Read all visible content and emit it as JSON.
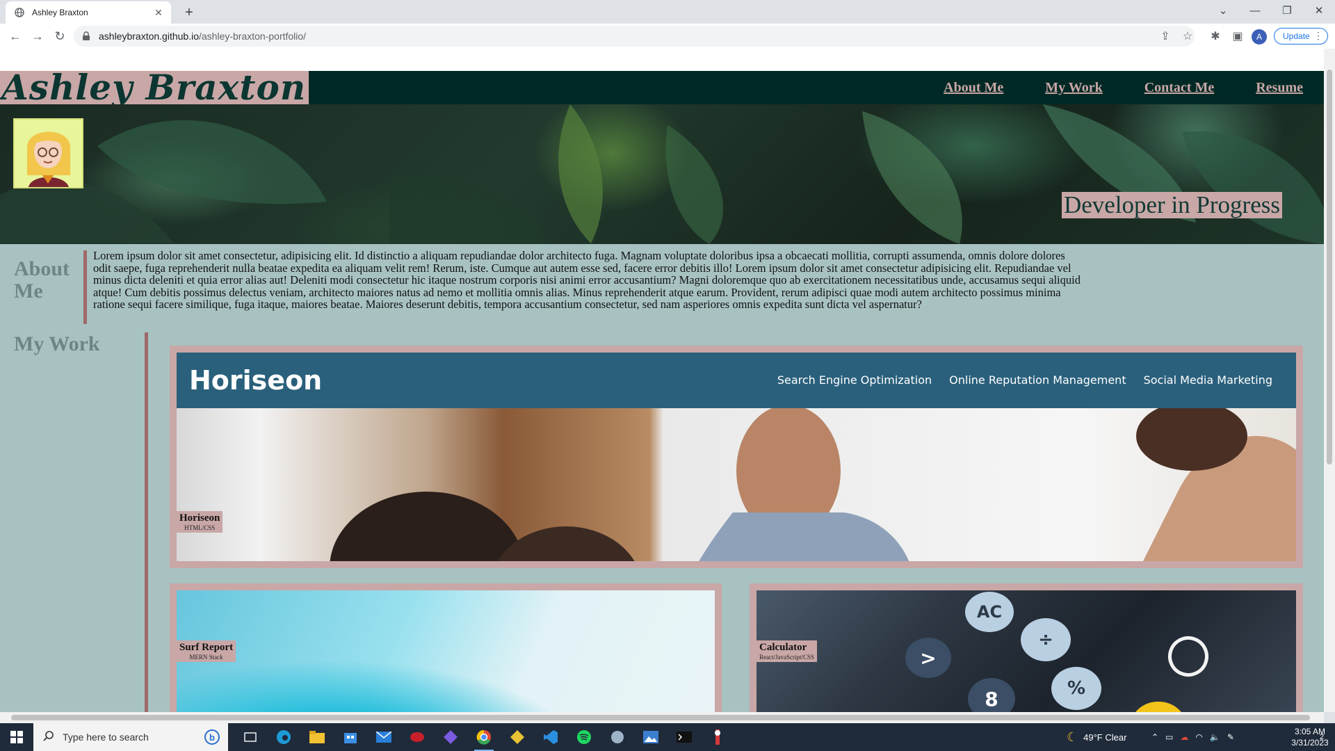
{
  "browser": {
    "tab_title": "Ashley Braxton",
    "new_tab_label": "+",
    "url_host": "ashleybraxton.github.io",
    "url_path": "/ashley-braxton-portfolio/",
    "update_label": "Update",
    "avatar_initial": "A"
  },
  "site": {
    "title": "Ashley Braxton",
    "nav": [
      "About Me",
      "My Work",
      "Contact Me",
      "Resume"
    ],
    "tagline": "Developer in Progress",
    "about_heading": "About Me",
    "about_text": "Lorem ipsum dolor sit amet consectetur, adipisicing elit. Id distinctio a aliquam repudiandae dolor architecto fuga. Magnam voluptate doloribus ipsa a obcaecati mollitia, corrupti assumenda, omnis dolore dolores odit saepe, fuga reprehenderit nulla beatae expedita ea aliquam velit rem! Rerum, iste. Cumque aut autem esse sed, facere error debitis illo! Lorem ipsum dolor sit amet consectetur adipisicing elit. Repudiandae vel minus dicta deleniti et quia error alias aut! Deleniti modi consectetur hic itaque nostrum corporis nisi animi error accusantium? Magni doloremque quo ab exercitationem necessitatibus unde, accusamus sequi aliquid atque! Cum debitis possimus delectus veniam, architecto maiores natus ad nemo et mollitia omnis alias. Minus reprehenderit atque earum. Provident, rerum adipisci quae modi autem architecto possimus minima ratione sequi facere similique, fuga itaque, maiores beatae. Maiores deserunt debitis, tempora accusantium consectetur, sed nam asperiores omnis expedita sunt dicta vel aspernatur?",
    "work_heading": "My Work",
    "projects": [
      {
        "name": "Horiseon",
        "tech": "HTML/CSS",
        "screenshot": {
          "logo": "Horiseon",
          "nav": [
            "Search Engine Optimization",
            "Online Reputation Management",
            "Social Media Marketing"
          ]
        }
      },
      {
        "name": "Surf Report",
        "tech": "MERN Stack"
      },
      {
        "name": "Calculator",
        "tech": "React/JavaScript/CSS",
        "keys": [
          "AC",
          ">",
          "÷",
          "%",
          "8"
        ]
      }
    ]
  },
  "taskbar": {
    "search_placeholder": "Type here to search",
    "weather": "49°F  Clear",
    "time": "3:05 AM",
    "date": "3/31/2023",
    "notification_count": "2"
  },
  "colors": {
    "header_bg": "#002925",
    "accent_pink": "#c9a7a7",
    "content_bg": "#a8c2c2",
    "rule": "#9e6a6a",
    "horiseon_blue": "#2a607c"
  }
}
